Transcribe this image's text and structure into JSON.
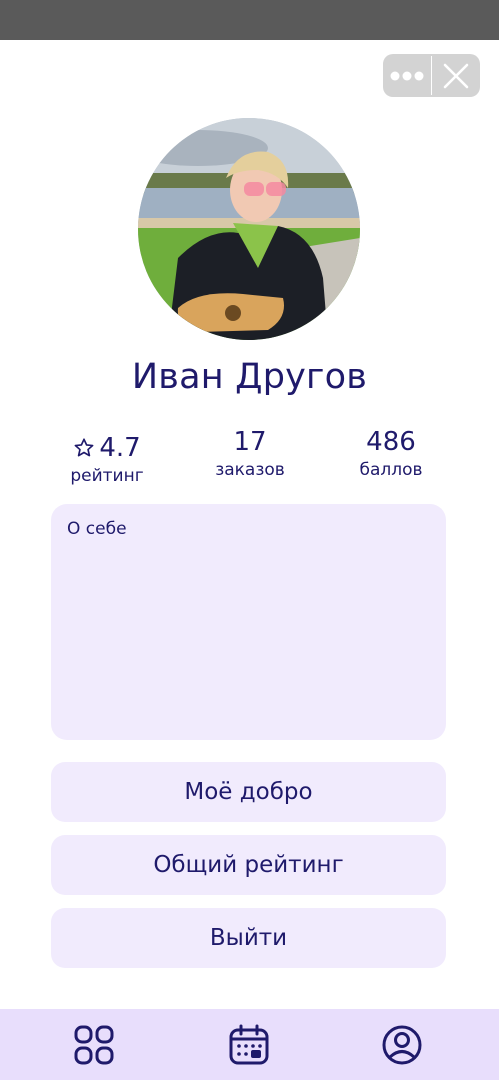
{
  "profile": {
    "name": "Иван Другов",
    "avatar_alt": "profile photo"
  },
  "stats": {
    "rating": {
      "value": "4.7",
      "label": "рейтинг"
    },
    "orders": {
      "value": "17",
      "label": "заказов"
    },
    "points": {
      "value": "486",
      "label": "баллов"
    }
  },
  "about": {
    "label": "О себе",
    "text": ""
  },
  "menu": {
    "my_good": "Моё добро",
    "overall_rating": "Общий рейтинг",
    "logout": "Выйти"
  },
  "bottom_nav": {
    "items": [
      "grid-icon",
      "calendar-icon",
      "profile-icon"
    ]
  },
  "colors": {
    "accent": "#1f1a6b",
    "surface": "#f1ebfd",
    "nav_bg": "#e8defc",
    "status_bar": "#5a5a5a"
  }
}
